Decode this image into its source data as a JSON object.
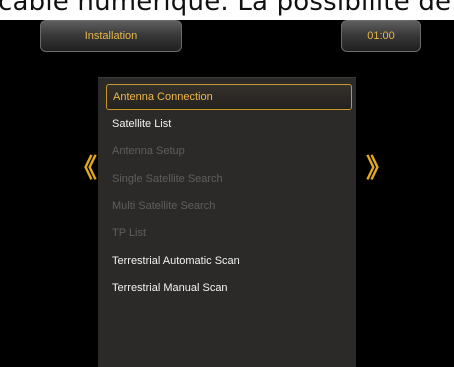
{
  "background_text": "câble numérique. La possibilité de",
  "header": {
    "title": "Installation",
    "clock": "01:00"
  },
  "nav": {
    "left_arrow": "《",
    "right_arrow": "》"
  },
  "menu": {
    "items": [
      {
        "label": "Antenna Connection",
        "state": "selected"
      },
      {
        "label": "Satellite List",
        "state": "enabled"
      },
      {
        "label": "Antenna Setup",
        "state": "disabled"
      },
      {
        "label": "Single Satellite Search",
        "state": "disabled"
      },
      {
        "label": "Multi Satellite Search",
        "state": "disabled"
      },
      {
        "label": "TP List",
        "state": "disabled"
      },
      {
        "label": "Terrestrial Automatic Scan",
        "state": "enabled"
      },
      {
        "label": "Terrestrial Manual Scan",
        "state": "enabled"
      }
    ]
  },
  "colors": {
    "accent": "#e8b84a",
    "panel": "#2b2a28",
    "disabled_text": "#5f5e5b",
    "enabled_text": "#f2f2f2"
  }
}
